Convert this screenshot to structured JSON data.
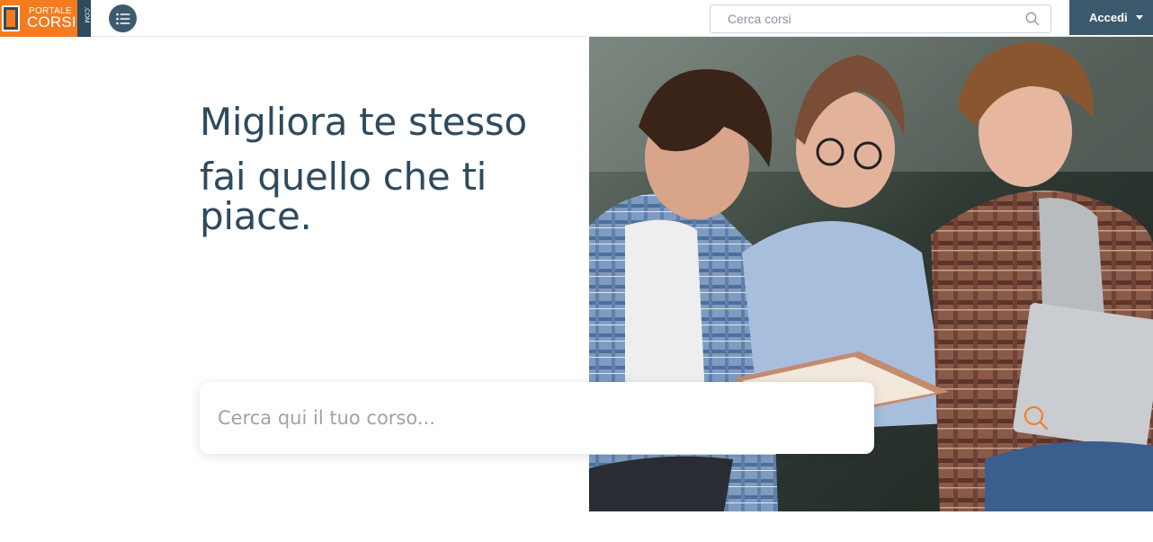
{
  "header": {
    "logo": {
      "top_text": "PORTALE",
      "main_text": "CORSI",
      "side_text": ".COM"
    },
    "search": {
      "placeholder": "Cerca corsi"
    },
    "login_label": "Accedi"
  },
  "hero": {
    "line1": "Migliora te stesso",
    "line2": "fai quello che ti piace.",
    "search": {
      "placeholder": "Cerca qui il tuo corso..."
    }
  },
  "icons": {
    "menu": "list-menu-icon",
    "top_search": "search-icon",
    "hero_search": "search-icon",
    "login_caret": "caret-down-icon"
  },
  "colors": {
    "brand_orange": "#f47b20",
    "brand_dark": "#2e4a5e",
    "button_bg": "#3c5a6e"
  }
}
